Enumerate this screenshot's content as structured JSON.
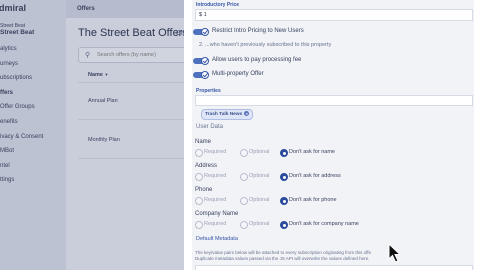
{
  "sidebar": {
    "brand": "dmiral",
    "publication_label": "Street Beat",
    "publication_name": "Street Beat",
    "items": [
      "alytics",
      "urneys",
      "ubscriptions",
      "ffers",
      "Offer Groups",
      "enefits",
      "ivacy & Consent",
      "MBot",
      "ntel",
      "ttings"
    ],
    "active_index": 3
  },
  "topbar": {
    "title": "Offers"
  },
  "page": {
    "title": "The Street Beat Offers",
    "title_tail": "Off",
    "search_placeholder": "Search offers (by name)",
    "column_name": "Name",
    "sort_icon": "sort-down-icon",
    "rows": [
      "Annual Plan",
      "Monthly Plan"
    ]
  },
  "modal": {
    "intro_price_label": "Introductory Price",
    "intro_price_value": "$ 1",
    "toggles": [
      {
        "label": "Restrict Intro Pricing to New Users",
        "on": true
      },
      {
        "label": "Allow users to pay processing fee",
        "on": true
      },
      {
        "label": "Multi-property Offer",
        "on": true
      }
    ],
    "sub_note": "2. ...who haven't previously subscribed to this property",
    "properties_label": "Properties",
    "property_tag": "Trash Talk News",
    "user_data_label": "User Data",
    "fields": [
      {
        "name": "Name",
        "options": [
          "Required",
          "Optional",
          "Don't ask for name"
        ],
        "selected": 2
      },
      {
        "name": "Address",
        "options": [
          "Required",
          "Optional",
          "Don't ask for address"
        ],
        "selected": 2
      },
      {
        "name": "Phone",
        "options": [
          "Required",
          "Optional",
          "Don't ask for phone"
        ],
        "selected": 2
      },
      {
        "name": "Company Name",
        "options": [
          "Required",
          "Optional",
          "Don't ask for company name"
        ],
        "selected": 2
      }
    ],
    "default_metadata_label": "Default Metadata",
    "metadata_note_1": "The key/value pairs below will be attached to every subscription originating from this offe",
    "metadata_note_2": "Duplicate metadata values passed via the JS API will overwrite the values defined here."
  },
  "colors": {
    "accent": "#2a4a9c",
    "toggle_on": "#4d70bf",
    "overlay_main": "#c9ceda",
    "overlay_sidebar": "#bcc2d2"
  }
}
